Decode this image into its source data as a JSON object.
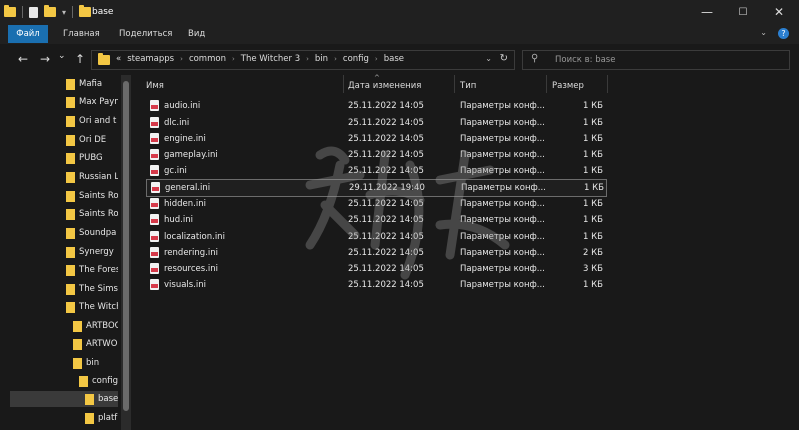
{
  "titlebar": {
    "title": "base",
    "controls": {
      "minimize": "—",
      "maximize": "☐",
      "close": "✕"
    }
  },
  "ribbon": {
    "tabs": [
      "Файл",
      "Главная",
      "Поделиться",
      "Вид"
    ],
    "help": "?"
  },
  "nav": {
    "back": "←",
    "forward": "→",
    "recent": "⌄",
    "up": "↑",
    "path": [
      "steamapps",
      "common",
      "The Witcher 3",
      "bin",
      "config",
      "base"
    ],
    "overflow": "«"
  },
  "search": {
    "placeholder": "Поиск в: base"
  },
  "sidebar": {
    "items": [
      {
        "label": "Mafia"
      },
      {
        "label": "Max Payn"
      },
      {
        "label": "Ori and t"
      },
      {
        "label": "Ori DE"
      },
      {
        "label": "PUBG"
      },
      {
        "label": "Russian L"
      },
      {
        "label": "Saints Ro"
      },
      {
        "label": "Saints Ro"
      },
      {
        "label": "Soundpa"
      },
      {
        "label": "Synergy"
      },
      {
        "label": "The Fores"
      },
      {
        "label": "The Sims"
      },
      {
        "label": "The Witch"
      },
      {
        "label": "ARTBOO"
      },
      {
        "label": "ARTWO"
      },
      {
        "label": "bin"
      },
      {
        "label": "config"
      },
      {
        "label": "base"
      },
      {
        "label": "platf"
      }
    ]
  },
  "columns": {
    "name": "Имя",
    "date": "Дата изменения",
    "type": "Тип",
    "size": "Размер"
  },
  "files": [
    {
      "name": "audio.ini",
      "date": "25.11.2022 14:05",
      "type": "Параметры конф...",
      "size": "1 КБ"
    },
    {
      "name": "dlc.ini",
      "date": "25.11.2022 14:05",
      "type": "Параметры конф...",
      "size": "1 КБ"
    },
    {
      "name": "engine.ini",
      "date": "25.11.2022 14:05",
      "type": "Параметры конф...",
      "size": "1 КБ"
    },
    {
      "name": "gameplay.ini",
      "date": "25.11.2022 14:05",
      "type": "Параметры конф...",
      "size": "1 КБ"
    },
    {
      "name": "gc.ini",
      "date": "25.11.2022 14:05",
      "type": "Параметры конф...",
      "size": "1 КБ"
    },
    {
      "name": "general.ini",
      "date": "29.11.2022 19:40",
      "type": "Параметры конф...",
      "size": "1 КБ"
    },
    {
      "name": "hidden.ini",
      "date": "25.11.2022 14:05",
      "type": "Параметры конф...",
      "size": "1 КБ"
    },
    {
      "name": "hud.ini",
      "date": "25.11.2022 14:05",
      "type": "Параметры конф...",
      "size": "1 КБ"
    },
    {
      "name": "localization.ini",
      "date": "25.11.2022 14:05",
      "type": "Параметры конф...",
      "size": "1 КБ"
    },
    {
      "name": "rendering.ini",
      "date": "25.11.2022 14:05",
      "type": "Параметры конф...",
      "size": "2 КБ"
    },
    {
      "name": "resources.ini",
      "date": "25.11.2022 14:05",
      "type": "Параметры конф...",
      "size": "3 КБ"
    },
    {
      "name": "visuals.ini",
      "date": "25.11.2022 14:05",
      "type": "Параметры конф...",
      "size": "1 КБ"
    }
  ],
  "colors": {
    "accent": "#1a6fb0",
    "background": "#191919",
    "folder": "#f3c744"
  }
}
